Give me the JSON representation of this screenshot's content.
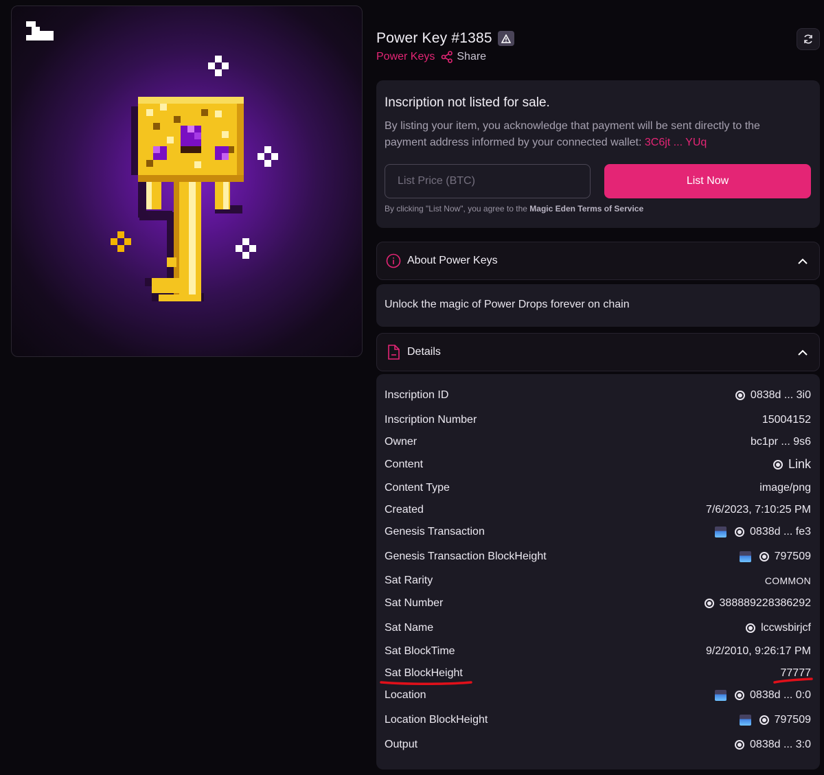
{
  "item": {
    "title": "Power Key #1385",
    "collection": "Power Keys",
    "share_label": "Share"
  },
  "listing": {
    "heading": "Inscription not listed for sale.",
    "description": "By listing your item, you acknowledge that payment will be sent directly to the payment address informed by your connected wallet: ",
    "wallet": "3C6jt ... YUq",
    "price_placeholder": "List Price (BTC)",
    "list_button": "List Now",
    "terms_prefix": "By clicking \"List Now\", you agree to the ",
    "terms_link": "Magic Eden Terms of Service"
  },
  "about": {
    "header": "About Power Keys",
    "body": "Unlock the magic of Power Drops forever on chain"
  },
  "details": {
    "header": "Details",
    "rows": [
      {
        "label": "Inscription ID",
        "value": "0838d ... 3i0"
      },
      {
        "label": "Inscription Number",
        "value": "15004152"
      },
      {
        "label": "Owner",
        "value": "bc1pr ... 9s6"
      },
      {
        "label": "Content",
        "value": "Link"
      },
      {
        "label": "Content Type",
        "value": "image/png"
      },
      {
        "label": "Created",
        "value": "7/6/2023, 7:10:25 PM"
      },
      {
        "label": "Genesis Transaction",
        "value": "0838d ... fe3"
      },
      {
        "label": "Genesis Transaction BlockHeight",
        "value": "797509"
      },
      {
        "label": "Sat Rarity",
        "value": "COMMON"
      },
      {
        "label": "Sat Number",
        "value": "388889228386292"
      },
      {
        "label": "Sat Name",
        "value": "lccwsbirjcf"
      },
      {
        "label": "Sat BlockTime",
        "value": "9/2/2010, 9:26:17 PM"
      },
      {
        "label": "Sat BlockHeight",
        "value": "77777"
      },
      {
        "label": "Location",
        "value": "0838d ... 0:0"
      },
      {
        "label": "Location BlockHeight",
        "value": "797509"
      },
      {
        "label": "Output",
        "value": "0838d ... 3:0"
      }
    ]
  },
  "icons": {
    "logo": "magic-eden-logo",
    "warning": "warning-triangle-icon",
    "share": "share-icon",
    "refresh": "refresh-icon",
    "info": "info-circle-icon",
    "document": "document-icon",
    "chevron": "chevron-up-icon",
    "link_dot": "circle-dot-icon",
    "mempool": "mempool-icon"
  },
  "colors": {
    "accent": "#e42575",
    "background": "#0a080d",
    "card": "#1c1a24",
    "annotation": "#e0101a"
  }
}
